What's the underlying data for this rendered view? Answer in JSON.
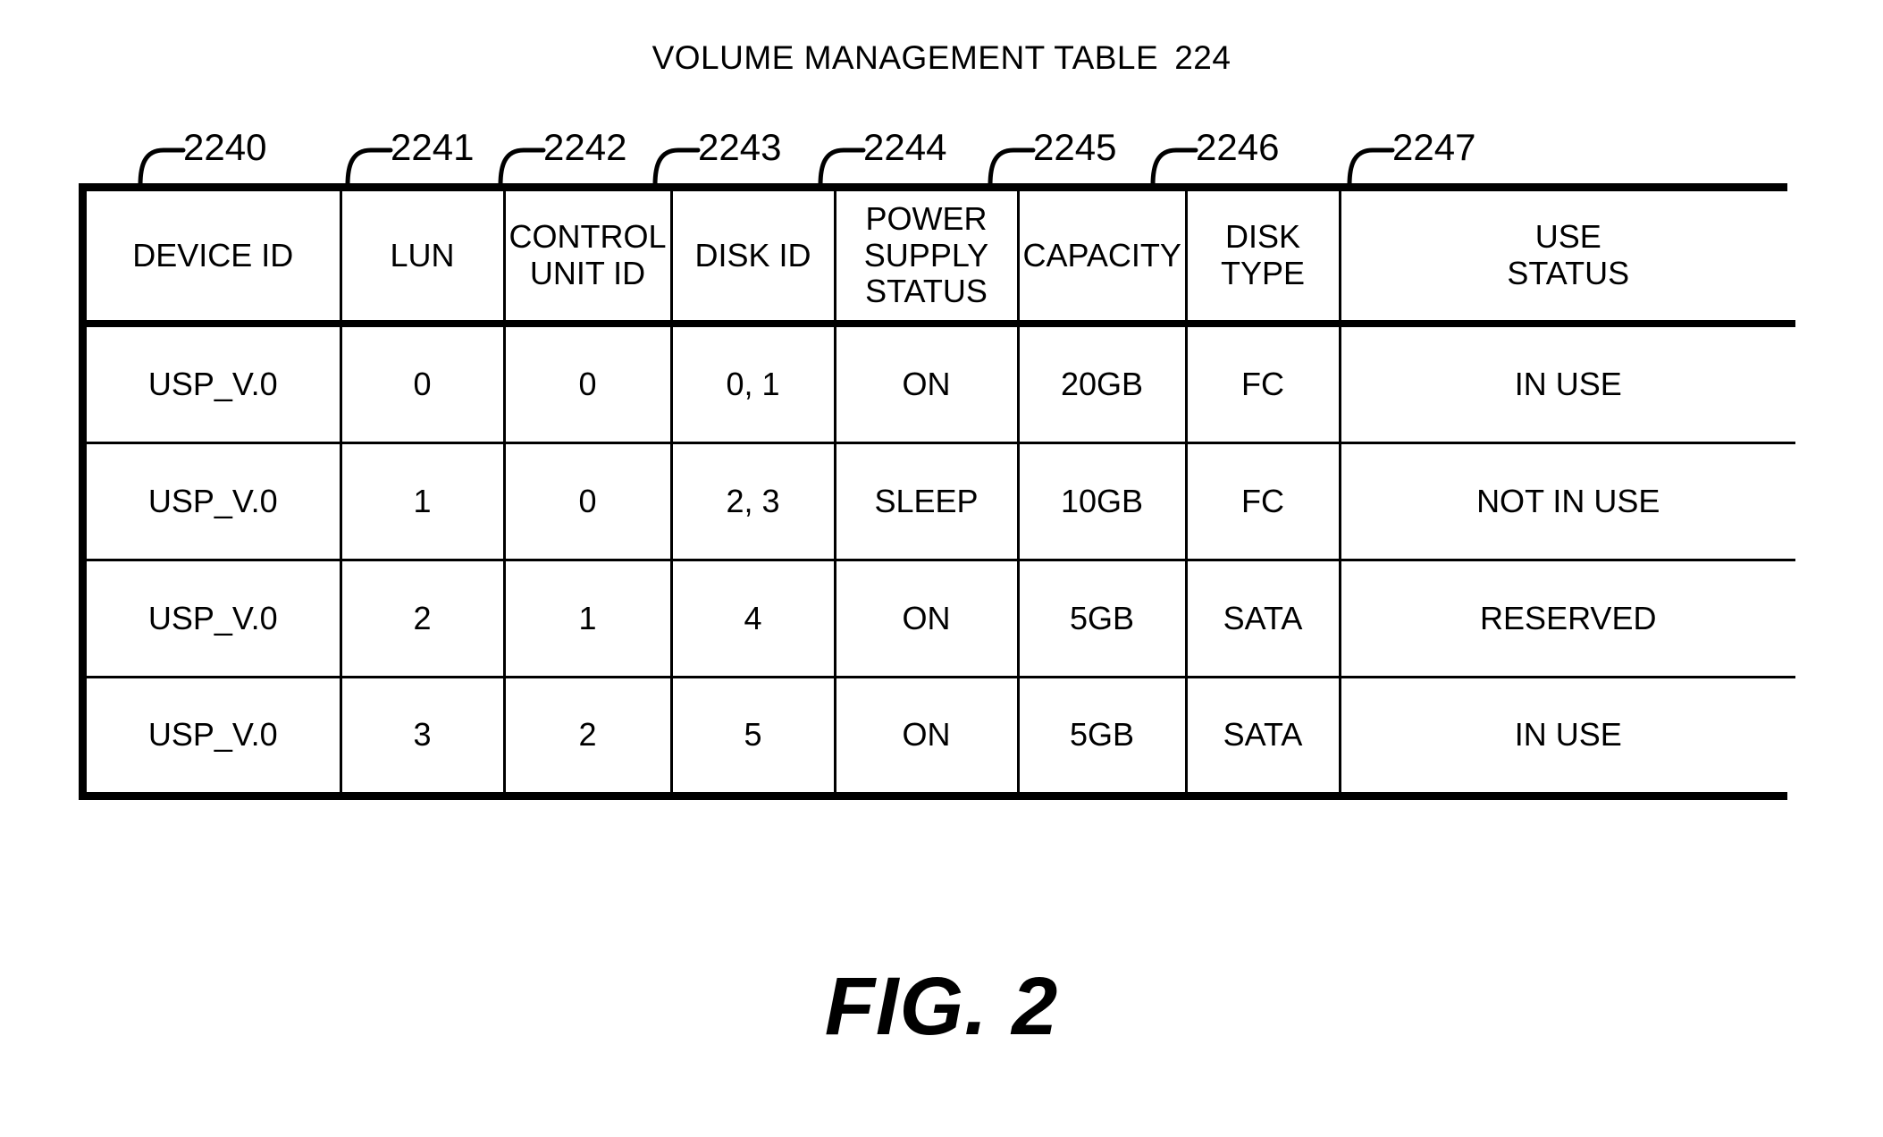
{
  "figure": {
    "title_text": "VOLUME MANAGEMENT TABLE",
    "title_ref": "224",
    "caption": "FIG. 2"
  },
  "callouts": [
    {
      "label": "2240",
      "target_column": "DEVICE ID"
    },
    {
      "label": "2241",
      "target_column": "LUN"
    },
    {
      "label": "2242",
      "target_column": "CONTROL UNIT ID"
    },
    {
      "label": "2243",
      "target_column": "DISK ID"
    },
    {
      "label": "2244",
      "target_column": "POWER SUPPLY STATUS"
    },
    {
      "label": "2245",
      "target_column": "CAPACITY"
    },
    {
      "label": "2246",
      "target_column": "DISK TYPE"
    },
    {
      "label": "2247",
      "target_column": "USE STATUS"
    }
  ],
  "table": {
    "headers": [
      "DEVICE ID",
      "LUN",
      "CONTROL\nUNIT ID",
      "DISK ID",
      "POWER\nSUPPLY\nSTATUS",
      "CAPACITY",
      "DISK\nTYPE",
      "USE\nSTATUS"
    ],
    "rows": [
      {
        "device_id": "USP_V.0",
        "lun": "0",
        "control_unit_id": "0",
        "disk_id": "0, 1",
        "power_supply_status": "ON",
        "capacity": "20GB",
        "disk_type": "FC",
        "use_status": "IN USE"
      },
      {
        "device_id": "USP_V.0",
        "lun": "1",
        "control_unit_id": "0",
        "disk_id": "2, 3",
        "power_supply_status": "SLEEP",
        "capacity": "10GB",
        "disk_type": "FC",
        "use_status": "NOT IN USE"
      },
      {
        "device_id": "USP_V.0",
        "lun": "2",
        "control_unit_id": "1",
        "disk_id": "4",
        "power_supply_status": "ON",
        "capacity": "5GB",
        "disk_type": "SATA",
        "use_status": "RESERVED"
      },
      {
        "device_id": "USP_V.0",
        "lun": "3",
        "control_unit_id": "2",
        "disk_id": "5",
        "power_supply_status": "ON",
        "capacity": "5GB",
        "disk_type": "SATA",
        "use_status": "IN USE"
      }
    ]
  },
  "colors": {
    "ink": "#000000",
    "paper": "#ffffff"
  }
}
